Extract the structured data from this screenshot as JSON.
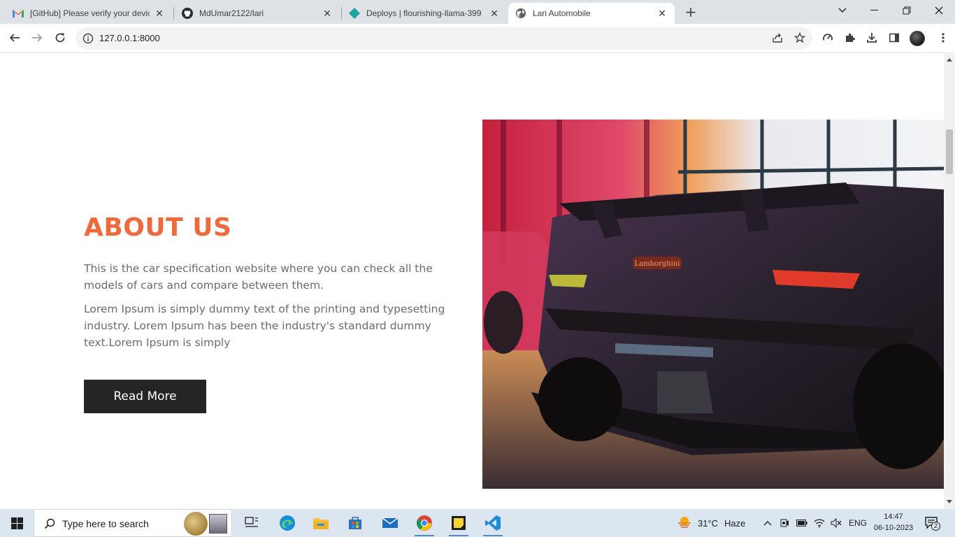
{
  "browser": {
    "tabs": [
      {
        "title": "[GitHub] Please verify your devic",
        "favicon": "gmail-icon",
        "active": false
      },
      {
        "title": "MdUmar2122/lari",
        "favicon": "github-icon",
        "active": false
      },
      {
        "title": "Deploys | flourishing-llama-399",
        "favicon": "netlify-icon",
        "active": false
      },
      {
        "title": "Lari Automobile",
        "favicon": "globe-icon",
        "active": true
      }
    ],
    "new_tab": "+",
    "url": "127.0.0.1:8000"
  },
  "page": {
    "about": {
      "title": "ABOUT US",
      "paragraph1": "This is the car specification website where you can check all the models of cars and compare between them.",
      "paragraph2": "Lorem Ipsum is simply dummy text of the printing and typesetting industry. Lorem Ipsum has been the industry's standard dummy text.Lorem Ipsum is simply",
      "button_label": "Read More"
    },
    "image": {
      "badge_text": "Lamborghini"
    }
  },
  "colors": {
    "accent": "#ee6a3c",
    "button_bg": "#252525",
    "body_text": "#6b6b6b"
  },
  "taskbar": {
    "search_placeholder": "Type here to search",
    "weather_temp": "31°C",
    "weather_desc": "Haze",
    "language": "ENG",
    "time": "14:47",
    "date": "06-10-2023",
    "notification_count": "2"
  }
}
